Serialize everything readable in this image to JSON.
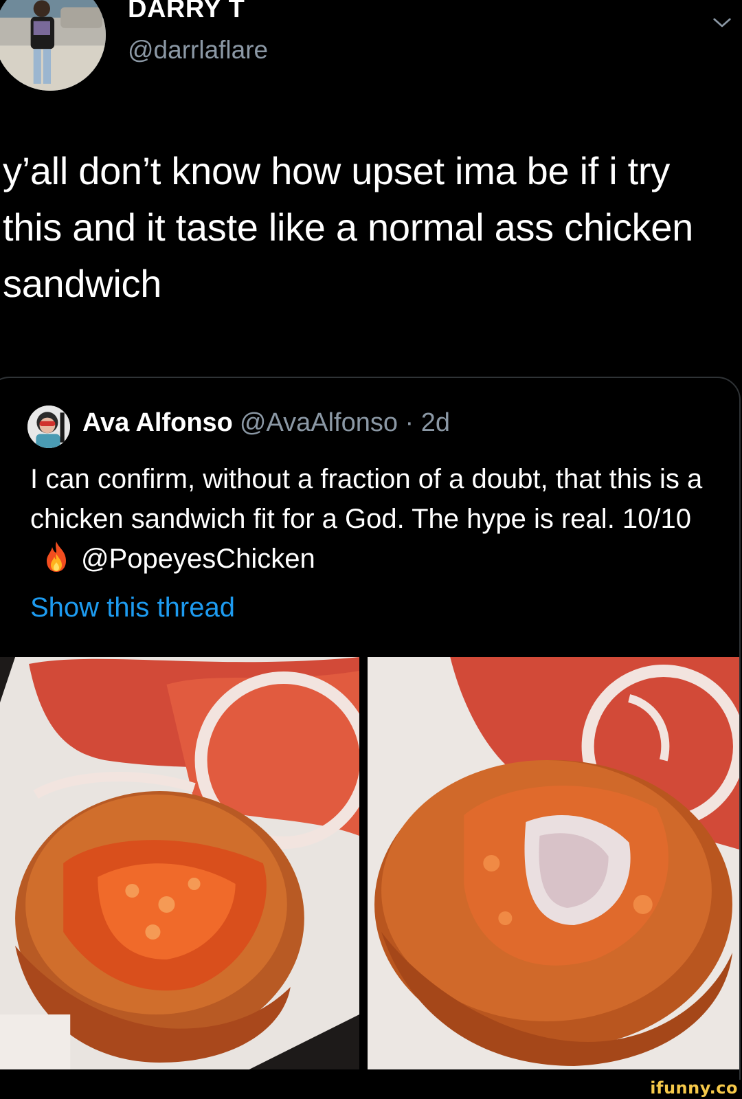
{
  "tweet": {
    "author": {
      "name": "DARRY T",
      "handle": "@darrlaflare"
    },
    "text": "y’all don’t know how upset ima be if i try this and it taste like a normal ass chicken sandwich",
    "menu_icon": "chevron-down-icon"
  },
  "quoted_tweet": {
    "author": {
      "name": "Ava Alfonso",
      "handle": "@AvaAlfonso · 2d"
    },
    "text_before_emoji": "I can confirm, without a fraction of a doubt, that this is a chicken sandwich fit for a God. The hype is real. 10/10",
    "emoji_icon": "fire-icon",
    "mention": "@PopeyesChicken",
    "show_thread_label": "Show this thread",
    "photos_count": 2
  },
  "watermark": "ifunny.co",
  "colors": {
    "background": "#000000",
    "text_primary": "#ffffff",
    "text_secondary": "#8b98a5",
    "link": "#1d9bf0",
    "border": "#2f3336",
    "watermark": "#f6c94a"
  }
}
